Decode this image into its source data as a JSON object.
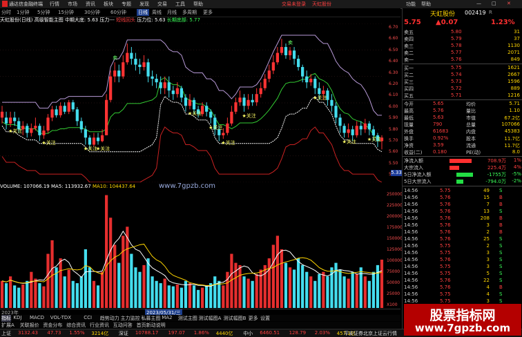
{
  "app": {
    "title": "通达信金融终端"
  },
  "menu": [
    "行情",
    "市场",
    "资讯",
    "板块",
    "专题",
    "发现",
    "交易",
    "工具",
    "帮助"
  ],
  "menu_red": [
    "交易未登录",
    "天虹股份"
  ],
  "menu_right": [
    "功能",
    "帮助"
  ],
  "toolbar_right": [
    "自选",
    "盘后",
    "板块",
    "统计",
    "资讯",
    "F10"
  ],
  "periods": [
    "分时",
    "1分钟",
    "5分钟",
    "15分钟",
    "30分钟",
    "60分钟",
    "日线",
    "周线",
    "月线",
    "多周期",
    "更多"
  ],
  "period_active": "日线",
  "chart_header": {
    "stock": "天虹股份(日线)",
    "indicator": "高级智能主图",
    "mid_label": "中期大底: 5.63",
    "pressure": "压力---",
    "tag1": "短线回头",
    "pressure2": "压力位: 5.63",
    "longterm": "长期底部: 5.77"
  },
  "price_axis": [
    "6.70",
    "6.60",
    "6.50",
    "6.40",
    "6.30",
    "6.20",
    "6.10",
    "6.00",
    "5.90",
    "5.80",
    "5.70",
    "5.60",
    "5.50",
    "5.40"
  ],
  "price_marker": "5.33",
  "volume_axis": [
    "250000",
    "225000",
    "200000",
    "175000",
    "150000",
    "125000",
    "100000",
    "75000",
    "50000",
    "25000",
    "X100"
  ],
  "volume_header": {
    "label": "VOLUME: 107066.19",
    "ma5": "MA5: 113932.67",
    "ma10": "MA10: 104437.64"
  },
  "annotations": [
    "关注",
    "关注",
    "关注",
    "关注",
    "关注",
    "关注",
    "关注",
    "关注",
    "关注",
    "关注",
    "关注",
    "卖",
    "卖",
    "卖"
  ],
  "watermark_text": "www.7gpzb.com",
  "date_label": "2023/05/31/三",
  "date_left": "2023年",
  "tabs_row1": [
    "指标",
    "KDJ",
    "MACD",
    "VOL-TDX",
    "CCI",
    "趋势动力",
    "主力监控",
    "私募主图",
    "MA2",
    "测试主图",
    "测试幅图A",
    "测试幅图B",
    "更多",
    "设置"
  ],
  "tabs_row2": [
    "扩展A",
    "关联报价",
    "资金分布",
    "综合资讯",
    "行业资讯",
    "互动问答",
    "首页新动说明"
  ],
  "quote": {
    "name": "天虹股份",
    "code": "002419",
    "flag": "R",
    "price": "5.75",
    "change": "▲0.07",
    "pct": "1.23%",
    "sells": [
      [
        "卖五",
        "5.80",
        "31"
      ],
      [
        "卖四",
        "5.79",
        "37"
      ],
      [
        "卖三",
        "5.78",
        "1130"
      ],
      [
        "卖二",
        "5.77",
        "2071"
      ],
      [
        "卖一",
        "5.76",
        "849"
      ]
    ],
    "buys": [
      [
        "买一",
        "5.75",
        "1621"
      ],
      [
        "买二",
        "5.74",
        "2667"
      ],
      [
        "买三",
        "5.73",
        "1596"
      ],
      [
        "买四",
        "5.72",
        "889"
      ],
      [
        "买五",
        "5.71",
        "1216"
      ]
    ],
    "stats": [
      [
        "今开",
        "5.65",
        "均价",
        "5.71"
      ],
      [
        "最高",
        "5.76",
        "量比",
        "1.10"
      ],
      [
        "最低",
        "5.63",
        "市值",
        "67.2亿"
      ],
      [
        "现量",
        "790",
        "总量",
        "107066"
      ],
      [
        "外盘",
        "61683",
        "内盘",
        "45383"
      ],
      [
        "换手",
        "0.92%",
        "股本",
        "11.7亿"
      ],
      [
        "净资",
        "3.59",
        "流通",
        "11.7亿"
      ],
      [
        "收益(二)",
        "0.180",
        "PE(动)",
        "8.0"
      ]
    ],
    "flows": [
      [
        "净流入额",
        "708.9万",
        "1%"
      ],
      [
        "大宗流入",
        "225.4万",
        "4%"
      ],
      [
        "5日净流入额",
        "-1755万",
        "-5%"
      ],
      [
        "5日大宗流入",
        "-794.0万",
        "-2%"
      ]
    ],
    "ticks": [
      [
        "14:56",
        "5.75",
        "49",
        "S"
      ],
      [
        "14:56",
        "5.76",
        "15",
        "B"
      ],
      [
        "14:56",
        "5.76",
        "7",
        "B"
      ],
      [
        "14:56",
        "5.76",
        "13",
        "S"
      ],
      [
        "14:56",
        "5.76",
        "208",
        "B"
      ],
      [
        "14:56",
        "5.76",
        "3",
        "B"
      ],
      [
        "14:56",
        "5.76",
        "2",
        "B"
      ],
      [
        "14:56",
        "5.76",
        "25",
        "S"
      ],
      [
        "14:56",
        "5.75",
        "2",
        "S"
      ],
      [
        "14:56",
        "5.75",
        "3",
        "S"
      ],
      [
        "14:56",
        "5.76",
        "3",
        "S"
      ],
      [
        "14:56",
        "5.75",
        "3",
        "S"
      ],
      [
        "14:56",
        "5.75",
        "5",
        "S"
      ],
      [
        "14:56",
        "5.76",
        "22",
        "S"
      ],
      [
        "14:56",
        "5.76",
        "4",
        "B"
      ],
      [
        "14:56",
        "5.75",
        "4",
        "S"
      ],
      [
        "14:56",
        "5.75",
        "3",
        "S"
      ],
      [
        "14:56",
        "5.75",
        "12",
        "S"
      ],
      [
        "14:56",
        "5.76",
        "1",
        "S"
      ],
      [
        "14:56",
        "5.75",
        "6",
        "S"
      ],
      [
        "14:56",
        "5.75",
        "3",
        "S"
      ],
      [
        "14:56",
        "5.76",
        "3",
        "S"
      ],
      [
        "14:56",
        "5.76",
        "1",
        "S"
      ]
    ]
  },
  "right_tabs": [
    "筹码",
    "盘",
    "更多"
  ],
  "status": {
    "items": [
      [
        "上证",
        "3132.43",
        "47.73",
        "1.55%",
        "3214亿"
      ],
      [
        "深证",
        "10788.17",
        "197.07",
        "1.86%",
        "4440亿"
      ],
      [
        "中小",
        "6460.51",
        "128.79",
        "2.03%",
        "457.1亿"
      ]
    ],
    "right": "平安证券北京上证云行情"
  },
  "watermark": {
    "line1": "股票指标网",
    "line2": "www.7gpzb.com"
  },
  "chart_data": {
    "type": "candlestick",
    "price_range": [
      5.4,
      6.75
    ],
    "candles": [
      [
        6.0,
        5.95,
        6.05,
        5.9,
        1
      ],
      [
        5.95,
        5.9,
        6.0,
        5.85,
        0
      ],
      [
        5.9,
        5.95,
        6.0,
        5.87,
        1
      ],
      [
        5.95,
        5.92,
        6.0,
        5.88,
        0
      ],
      [
        5.92,
        5.85,
        5.95,
        5.82,
        0
      ],
      [
        5.85,
        5.88,
        5.92,
        5.8,
        1
      ],
      [
        5.88,
        5.82,
        5.9,
        5.78,
        0
      ],
      [
        5.82,
        5.86,
        5.9,
        5.79,
        1
      ],
      [
        5.86,
        5.88,
        5.95,
        5.84,
        1
      ],
      [
        5.88,
        5.8,
        5.9,
        5.75,
        0
      ],
      [
        5.8,
        5.84,
        5.88,
        5.77,
        1
      ],
      [
        5.84,
        5.95,
        5.98,
        5.82,
        1
      ],
      [
        5.95,
        6.02,
        6.05,
        5.92,
        1
      ],
      [
        6.02,
        5.97,
        6.05,
        5.95,
        0
      ],
      [
        5.97,
        6.05,
        6.08,
        5.95,
        1
      ],
      [
        6.05,
        6.0,
        6.08,
        5.98,
        0
      ],
      [
        6.0,
        6.08,
        6.1,
        5.98,
        1
      ],
      [
        6.08,
        6.02,
        6.1,
        6.0,
        0
      ],
      [
        6.02,
        5.92,
        6.04,
        5.88,
        0
      ],
      [
        5.92,
        5.85,
        5.95,
        5.82,
        0
      ],
      [
        5.85,
        5.78,
        5.88,
        5.72,
        0
      ],
      [
        5.78,
        5.72,
        5.8,
        5.68,
        0
      ],
      [
        5.72,
        5.78,
        5.82,
        5.7,
        1
      ],
      [
        5.78,
        5.75,
        5.82,
        5.72,
        0
      ],
      [
        5.75,
        5.8,
        5.85,
        5.74,
        1
      ],
      [
        5.8,
        6.1,
        6.15,
        5.8,
        1
      ],
      [
        6.1,
        6.3,
        6.35,
        6.08,
        1
      ],
      [
        6.3,
        6.35,
        6.42,
        6.25,
        1
      ],
      [
        6.35,
        6.3,
        6.4,
        6.25,
        0
      ],
      [
        6.3,
        6.42,
        6.48,
        6.28,
        1
      ],
      [
        6.42,
        6.5,
        6.58,
        6.4,
        1
      ],
      [
        6.5,
        6.45,
        6.55,
        6.4,
        0
      ],
      [
        6.45,
        6.4,
        6.5,
        6.35,
        0
      ],
      [
        6.4,
        6.38,
        6.45,
        6.32,
        0
      ],
      [
        6.38,
        6.42,
        6.48,
        6.35,
        1
      ],
      [
        6.42,
        6.3,
        6.45,
        6.25,
        0
      ],
      [
        6.3,
        6.28,
        6.35,
        6.22,
        0
      ],
      [
        6.28,
        6.25,
        6.32,
        6.2,
        0
      ],
      [
        6.25,
        6.2,
        6.3,
        6.15,
        0
      ],
      [
        6.2,
        6.25,
        6.3,
        6.15,
        1
      ],
      [
        6.25,
        6.18,
        6.3,
        6.12,
        0
      ],
      [
        6.18,
        6.15,
        6.22,
        6.1,
        0
      ],
      [
        6.15,
        6.2,
        6.25,
        6.12,
        1
      ],
      [
        6.2,
        6.12,
        6.22,
        6.08,
        0
      ],
      [
        6.12,
        6.05,
        6.15,
        6.0,
        0
      ],
      [
        6.05,
        6.1,
        6.15,
        6.02,
        1
      ],
      [
        6.1,
        6.02,
        6.12,
        5.98,
        0
      ],
      [
        6.02,
        5.98,
        6.05,
        5.95,
        0
      ],
      [
        5.98,
        6.05,
        6.08,
        5.96,
        1
      ],
      [
        6.05,
        6.0,
        6.08,
        5.96,
        0
      ],
      [
        6.0,
        5.95,
        6.02,
        5.9,
        0
      ],
      [
        5.95,
        5.85,
        5.98,
        5.8,
        0
      ],
      [
        5.85,
        5.8,
        5.88,
        5.75,
        0
      ],
      [
        5.8,
        5.82,
        5.86,
        5.77,
        1
      ],
      [
        5.82,
        5.9,
        5.95,
        5.8,
        1
      ],
      [
        5.9,
        6.0,
        6.05,
        5.88,
        1
      ],
      [
        6.0,
        6.08,
        6.12,
        5.98,
        1
      ],
      [
        6.08,
        6.12,
        6.18,
        6.05,
        1
      ],
      [
        6.12,
        6.05,
        6.15,
        6.0,
        0
      ],
      [
        6.05,
        6.1,
        6.15,
        6.02,
        1
      ],
      [
        6.1,
        6.08,
        6.15,
        6.05,
        0
      ],
      [
        6.08,
        6.15,
        6.2,
        6.05,
        1
      ],
      [
        6.15,
        6.2,
        6.25,
        6.12,
        1
      ],
      [
        6.2,
        6.28,
        6.32,
        6.18,
        1
      ],
      [
        6.28,
        6.35,
        6.4,
        6.25,
        1
      ],
      [
        6.35,
        6.42,
        6.48,
        6.32,
        1
      ],
      [
        6.42,
        6.5,
        6.55,
        6.4,
        1
      ],
      [
        6.5,
        6.55,
        6.62,
        6.48,
        1
      ],
      [
        6.55,
        6.48,
        6.58,
        6.45,
        0
      ],
      [
        6.48,
        6.52,
        6.55,
        6.44,
        1
      ],
      [
        6.52,
        6.45,
        6.55,
        6.4,
        0
      ],
      [
        6.45,
        6.38,
        6.48,
        6.35,
        0
      ],
      [
        6.38,
        6.3,
        6.4,
        6.25,
        0
      ],
      [
        6.3,
        6.25,
        6.35,
        6.2,
        0
      ],
      [
        6.25,
        6.28,
        6.32,
        6.22,
        1
      ],
      [
        6.28,
        6.2,
        6.3,
        6.15,
        0
      ],
      [
        6.2,
        6.15,
        6.25,
        6.1,
        0
      ],
      [
        6.15,
        6.18,
        6.22,
        6.1,
        1
      ],
      [
        6.18,
        6.1,
        6.2,
        6.05,
        0
      ],
      [
        6.1,
        6.05,
        6.15,
        6.0,
        0
      ],
      [
        6.05,
        5.95,
        6.08,
        5.9,
        0
      ],
      [
        5.95,
        5.88,
        5.98,
        5.82,
        0
      ],
      [
        5.88,
        5.82,
        5.9,
        5.78,
        0
      ],
      [
        5.82,
        5.85,
        5.9,
        5.78,
        1
      ],
      [
        5.85,
        5.8,
        5.88,
        5.75,
        0
      ],
      [
        5.8,
        5.88,
        5.92,
        5.78,
        1
      ],
      [
        5.88,
        5.85,
        5.92,
        5.8,
        0
      ],
      [
        5.85,
        5.9,
        5.94,
        5.82,
        1
      ],
      [
        5.9,
        5.85,
        5.92,
        5.8,
        0
      ],
      [
        5.85,
        5.8,
        5.88,
        5.75,
        0
      ],
      [
        5.8,
        5.75,
        5.82,
        5.7,
        0
      ],
      [
        5.75,
        5.78,
        5.8,
        5.68,
        1
      ]
    ],
    "volume_max": 260000,
    "volumes": [
      60000,
      55000,
      70000,
      50000,
      45000,
      52000,
      60000,
      80000,
      65000,
      55000,
      48000,
      120000,
      150000,
      90000,
      110000,
      70000,
      85000,
      60000,
      55000,
      70000,
      130000,
      90000,
      60000,
      50000,
      80000,
      250000,
      200000,
      140000,
      100000,
      160000,
      180000,
      120000,
      90000,
      80000,
      95000,
      110000,
      70000,
      60000,
      55000,
      65000,
      50000,
      48000,
      52000,
      45000,
      60000,
      55000,
      50000,
      40000,
      45000,
      50000,
      55000,
      70000,
      60000,
      50000,
      80000,
      120000,
      100000,
      95000,
      70000,
      65000,
      60000,
      75000,
      85000,
      95000,
      110000,
      140000,
      160000,
      130000,
      100000,
      90000,
      85000,
      110000,
      95000,
      80000,
      70000,
      60000,
      75000,
      80000,
      70000,
      90000,
      100000,
      85000,
      70000,
      65000,
      80000,
      75000,
      90000,
      70000,
      60000,
      80000,
      95000,
      107066
    ],
    "ma5_label": "MA5",
    "ma10_label": "MA10"
  }
}
